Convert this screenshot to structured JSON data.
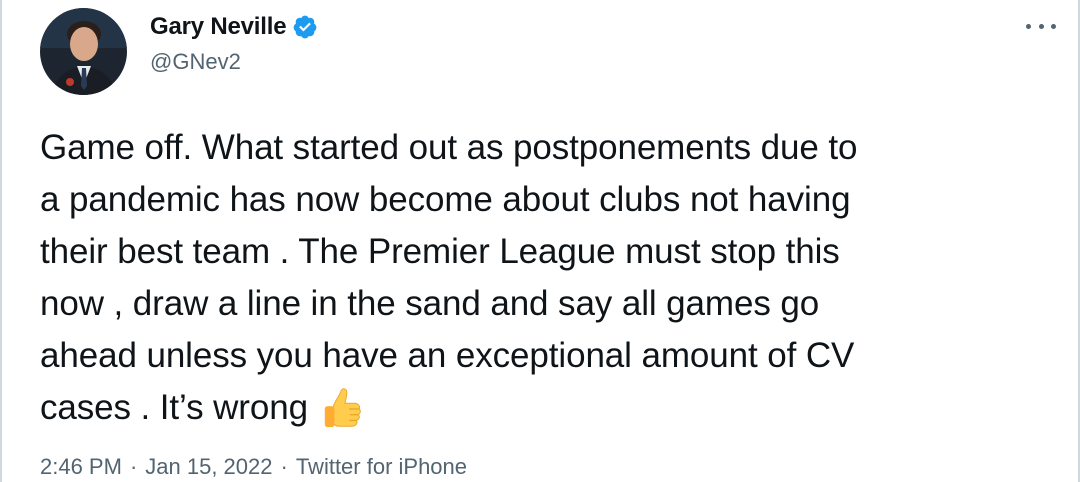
{
  "tweet": {
    "author": {
      "display_name": "Gary Neville",
      "handle": "@GNev2",
      "verified": true
    },
    "text": "Game off. What started out as postponements due to\na pandemic has now become about clubs not having\ntheir best team . The Premier League must stop this\nnow , draw a line in the sand and say all games go\nahead unless you have an exceptional amount of CV\ncases . It’s wrong",
    "emoji": "thumbs-up",
    "time": "2:46 PM",
    "date": "Jan 15, 2022",
    "source": "Twitter for iPhone",
    "separator": "·"
  },
  "colors": {
    "text": "#0f1419",
    "secondary": "#536471",
    "verified_blue": "#1d9bf0",
    "border": "#cfd9de"
  }
}
